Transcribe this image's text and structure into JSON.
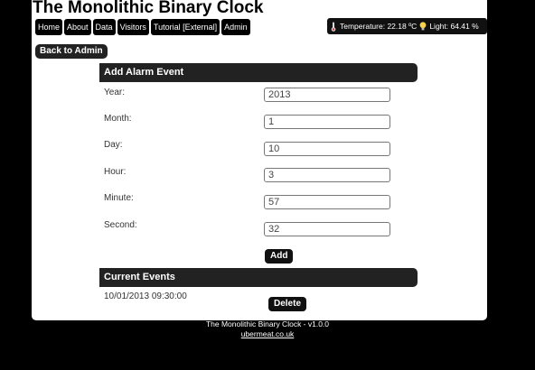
{
  "header": {
    "title": "The Monolithic Binary Clock",
    "nav": [
      "Home",
      "About",
      "Data",
      "Visitors",
      "Tutorial [External]",
      "Admin"
    ],
    "status": {
      "temperature": "Temperature: 22.18 ºC",
      "light": "Light: 64.41 %",
      "thermometer_icon": "thermometer-icon",
      "bulb_icon": "lightbulb-icon"
    }
  },
  "back_button": "Back to Admin",
  "alarm_form": {
    "heading": "Add Alarm Event",
    "fields": [
      {
        "label": "Year:",
        "value": "2013"
      },
      {
        "label": "Month:",
        "value": "1"
      },
      {
        "label": "Day:",
        "value": "10"
      },
      {
        "label": "Hour:",
        "value": "3"
      },
      {
        "label": "Minute:",
        "value": "57"
      },
      {
        "label": "Second:",
        "value": "32"
      }
    ],
    "add_button": "Add"
  },
  "current_events": {
    "heading": "Current Events",
    "events": [
      {
        "datetime": "10/01/2013 09:30:00",
        "delete_label": "Delete"
      }
    ]
  },
  "footer": {
    "version": "The Monolithic Binary Clock - v1.0.0",
    "link": "ubermeat.co.uk"
  },
  "colors": {
    "background": "#000000",
    "panel": "#ffffff",
    "header_bar": "#222222"
  }
}
